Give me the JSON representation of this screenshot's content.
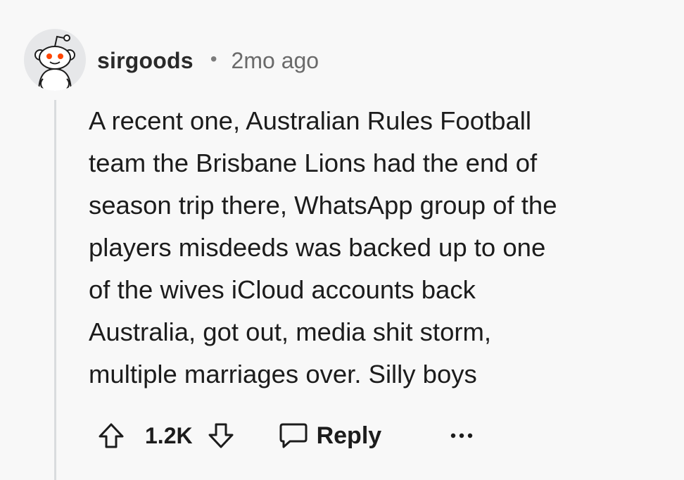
{
  "comment": {
    "username": "sirgoods",
    "separator": "•",
    "timestamp": "2mo ago",
    "body_lines": [
      "A recent one, Australian Rules Football",
      "team the Brisbane Lions had the end of",
      "season trip there, WhatsApp group of the",
      "players misdeeds was backed up to one",
      "of the wives iCloud accounts back",
      "Australia, got out, media shit storm,",
      "multiple marriages over. Silly boys"
    ]
  },
  "actions": {
    "score": "1.2K",
    "reply_label": "Reply",
    "upvote_icon": "upvote-arrow-icon",
    "downvote_icon": "downvote-arrow-icon",
    "reply_icon": "speech-bubble-icon",
    "more_icon": "ellipsis-icon"
  },
  "colors": {
    "background": "#f8f8f8",
    "avatar_accent": "#ff4500",
    "text": "#1c1c1c",
    "meta": "#6a6a6a"
  }
}
